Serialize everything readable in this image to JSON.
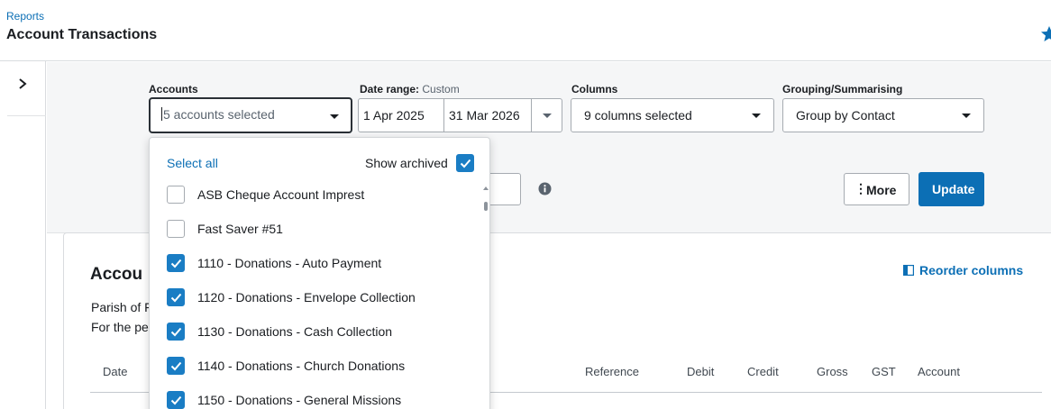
{
  "header": {
    "breadcrumb": "Reports",
    "title": "Account Transactions"
  },
  "filters": {
    "accounts": {
      "label": "Accounts",
      "value": "5 accounts selected"
    },
    "date_range": {
      "label": "Date range:",
      "mode": "Custom",
      "from": "1 Apr 2025",
      "to": "31 Mar 2026"
    },
    "columns": {
      "label": "Columns",
      "value": "9 columns selected"
    },
    "grouping": {
      "label": "Grouping/Summarising",
      "value": "Group by Contact"
    },
    "more_label": "More",
    "update_label": "Update"
  },
  "dropdown": {
    "select_all": "Select all",
    "show_archived": "Show archived",
    "show_archived_checked": true,
    "options": [
      {
        "label": "ASB Cheque Account Imprest",
        "checked": false
      },
      {
        "label": "Fast Saver #51",
        "checked": false
      },
      {
        "label": "1110 - Donations - Auto Payment",
        "checked": true
      },
      {
        "label": "1120 - Donations - Envelope Collection",
        "checked": true
      },
      {
        "label": "1130 - Donations - Cash Collection",
        "checked": true
      },
      {
        "label": "1140 - Donations - Church Donations",
        "checked": true
      },
      {
        "label": "1150 - Donations - General Missions",
        "checked": true
      }
    ]
  },
  "report": {
    "title_visible": "Accou",
    "org_visible": "Parish of F",
    "period_visible": "For the pe",
    "reorder_label": "Reorder columns",
    "columns": [
      "Date",
      "Reference",
      "Debit",
      "Credit",
      "Gross",
      "GST",
      "Account"
    ]
  },
  "colors": {
    "brand_blue": "#0c6fb5",
    "checkbox_blue": "#1a7dc4",
    "text": "#1a1d21"
  }
}
